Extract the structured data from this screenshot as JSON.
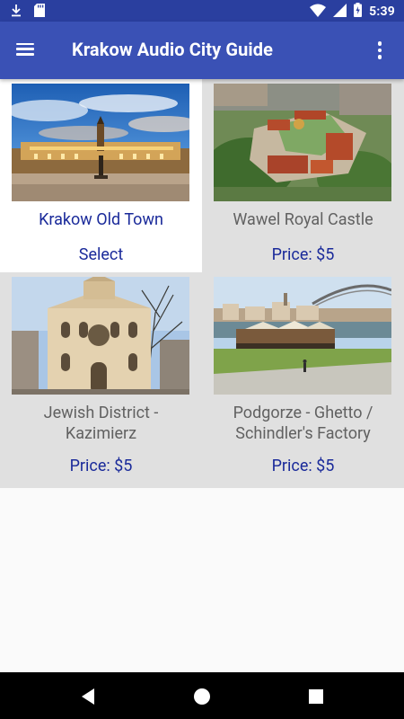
{
  "status_bar": {
    "time": "5:39",
    "icons": [
      "download-icon",
      "sd-card-icon",
      "wifi-icon",
      "signal-icon",
      "battery-charging-icon"
    ]
  },
  "app_bar": {
    "title": "Krakow Audio City Guide",
    "menu_icon": "hamburger-menu-icon",
    "overflow_icon": "more-vert-icon"
  },
  "tours": [
    {
      "name": "Krakow Old Town",
      "action": "Select",
      "selected": true
    },
    {
      "name": "Wawel Royal Castle",
      "action": "Price: $5",
      "selected": false
    },
    {
      "name": "Jewish District - Kazimierz",
      "action": "Price: $5",
      "selected": false
    },
    {
      "name": "Podgorze - Ghetto / Schindler's Factory",
      "action": "Price: $5",
      "selected": false
    }
  ],
  "tour_name_lines": {
    "t2_line1": "Jewish District -",
    "t2_line2": "Kazimierz",
    "t3_line1": "Podgorze - Ghetto /",
    "t3_line2": "Schindler's Factory"
  },
  "nav_bar": {
    "icons": [
      "back-icon",
      "home-icon",
      "recents-icon"
    ]
  },
  "colors": {
    "status_bar": "#2a3f9f",
    "app_bar": "#3a51b5",
    "accent_text": "#1a2a9a",
    "muted_text": "#616161",
    "grid_background": "#e0e0e0"
  }
}
